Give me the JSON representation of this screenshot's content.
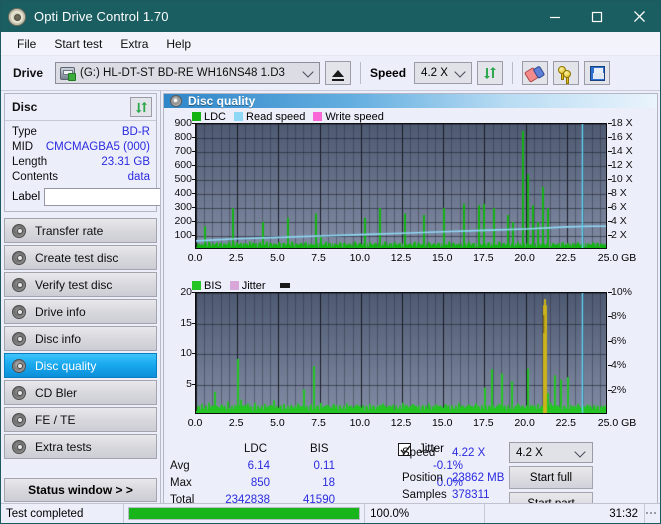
{
  "window": {
    "title": "Opti Drive Control 1.70",
    "icon": "disc-icon",
    "minimize": "minimize-icon",
    "maximize": "maximize-icon",
    "close": "close-icon"
  },
  "menu": {
    "items": [
      "File",
      "Start test",
      "Extra",
      "Help"
    ]
  },
  "toolbar": {
    "drive_label": "Drive",
    "drive_value": "(G:)   HL-DT-ST BD-RE  WH16NS48 1.D3",
    "eject_icon": "eject-icon",
    "speed_label": "Speed",
    "speed_value": "4.2 X",
    "refresh_icon": "refresh-icon",
    "erase_icon": "eraser-icon",
    "keys_icon": "keys-icon",
    "save_icon": "floppy-disk-icon"
  },
  "sidebar": {
    "disc_panel": {
      "title": "Disc",
      "refresh_icon": "refresh-icon",
      "rows": [
        {
          "key": "Type",
          "value": "BD-R"
        },
        {
          "key": "MID",
          "value": "CMCMAGBA5 (000)"
        },
        {
          "key": "Length",
          "value": "23.31 GB"
        },
        {
          "key": "Contents",
          "value": "data"
        }
      ],
      "label_key": "Label",
      "label_value": "",
      "label_placeholder": "",
      "label_button_icon": "disc-icon"
    },
    "nav": [
      {
        "label": "Transfer rate",
        "active": false
      },
      {
        "label": "Create test disc",
        "active": false
      },
      {
        "label": "Verify test disc",
        "active": false
      },
      {
        "label": "Drive info",
        "active": false
      },
      {
        "label": "Disc info",
        "active": false
      },
      {
        "label": "Disc quality",
        "active": true
      },
      {
        "label": "CD Bler",
        "active": false
      },
      {
        "label": "FE / TE",
        "active": false
      },
      {
        "label": "Extra tests",
        "active": false
      }
    ],
    "status_window_button": "Status window > >"
  },
  "main": {
    "panel_title": "Disc quality",
    "panel_icon": "disc-quality-icon"
  },
  "stats": {
    "col_headers": [
      "LDC",
      "BIS"
    ],
    "row_labels": [
      "Avg",
      "Max",
      "Total"
    ],
    "ldc": {
      "avg": "6.14",
      "max": "850",
      "total": "2342838"
    },
    "bis": {
      "avg": "0.11",
      "max": "18",
      "total": "41590"
    },
    "jitter": {
      "label": "Jitter",
      "checked": true,
      "avg": "-0.1%",
      "max": "0.0%"
    },
    "speed_label": "Speed",
    "speed_value": "4.22 X",
    "speed_select": "4.2 X",
    "position_label": "Position",
    "position_value": "23862 MB",
    "samples_label": "Samples",
    "samples_value": "378311",
    "start_full_button": "Start full",
    "start_part_button": "Start part"
  },
  "statusbar": {
    "message": "Test completed",
    "progress_percent": "100.0%",
    "progress_value": 100,
    "elapsed": "31:32"
  },
  "colors": {
    "title_bar": "#1b5e62",
    "accent": "#0b8fd8",
    "ldc_green": "#12b312",
    "read_speed_blue": "#8fd8f5",
    "write_speed_pink": "#f866d8",
    "bis_green": "#23c423",
    "jitter_pink": "#d9a6d9",
    "jitter_trace": "#cbb31a",
    "plot_bg_top": "#4e5a72",
    "plot_bg_bottom": "#7d88a0",
    "value_blue": "#2a2ae0",
    "progress_green": "#17b51a"
  },
  "chart_data": [
    {
      "id": "ldc-chart",
      "type": "bar",
      "title": "",
      "legend": [
        {
          "label": "LDC",
          "color": "#12b312"
        },
        {
          "label": "Read speed",
          "color": "#8fd8f5"
        },
        {
          "label": "Write speed",
          "color": "#f866d8"
        }
      ],
      "legend_position": "top-left",
      "grid": true,
      "xlabel": "GB",
      "xlim": [
        0,
        25
      ],
      "xticks": [
        "0.0",
        "2.5",
        "5.0",
        "7.5",
        "10.0",
        "12.5",
        "15.0",
        "17.5",
        "20.0",
        "22.5",
        "25.0"
      ],
      "xtick_suffix": "GB",
      "ylabel": "",
      "ylim": [
        0,
        900
      ],
      "yticks": [
        100,
        200,
        300,
        400,
        500,
        600,
        700,
        800,
        900
      ],
      "y2label": "",
      "y2lim": [
        0,
        18
      ],
      "y2ticks": [
        "2 X",
        "4 X",
        "6 X",
        "8 X",
        "10 X",
        "12 X",
        "14 X",
        "16 X",
        "18 X"
      ],
      "series": [
        {
          "name": "LDC",
          "color": "#12b312",
          "type": "bar",
          "x": [
            0.15,
            0.3,
            0.5,
            0.7,
            0.95,
            1.2,
            1.45,
            1.7,
            1.95,
            2.2,
            2.45,
            2.7,
            2.85,
            3.0,
            3.2,
            3.4,
            3.6,
            3.8,
            4.0,
            4.25,
            4.5,
            4.75,
            5.0,
            5.25,
            5.5,
            5.75,
            6.0,
            6.3,
            6.6,
            6.9,
            7.2,
            7.5,
            7.8,
            8.1,
            8.4,
            8.7,
            9.0,
            9.3,
            9.6,
            9.9,
            10.2,
            10.5,
            10.8,
            11.1,
            11.4,
            11.7,
            12.0,
            12.3,
            12.6,
            12.9,
            13.2,
            13.5,
            13.8,
            14.1,
            14.4,
            14.7,
            15.0,
            15.3,
            15.6,
            15.9,
            16.2,
            16.5,
            16.8,
            17.1,
            17.4,
            17.7,
            18.0,
            18.3,
            18.6,
            18.9,
            19.2,
            19.5,
            19.8,
            20.1,
            20.4,
            20.7,
            21.0,
            21.3,
            21.6,
            21.9,
            22.2,
            22.5,
            22.8,
            23.1,
            23.4,
            23.7,
            24.0,
            24.3,
            24.6
          ],
          "values": [
            40,
            35,
            170,
            60,
            45,
            55,
            50,
            45,
            60,
            300,
            55,
            50,
            45,
            40,
            60,
            50,
            45,
            55,
            200,
            60,
            50,
            45,
            55,
            50,
            230,
            60,
            45,
            50,
            55,
            45,
            260,
            95,
            60,
            50,
            45,
            55,
            50,
            45,
            60,
            50,
            230,
            55,
            50,
            300,
            60,
            45,
            55,
            50,
            260,
            45,
            60,
            50,
            250,
            55,
            45,
            50,
            300,
            60,
            50,
            45,
            330,
            60,
            50,
            320,
            330,
            55,
            300,
            60,
            50,
            250,
            200,
            60,
            850,
            540,
            320,
            200,
            450,
            300,
            50,
            45,
            55,
            50,
            45,
            55,
            50,
            45,
            55,
            50,
            45
          ]
        },
        {
          "name": "Read speed",
          "color": "#8fd8f5",
          "type": "line",
          "axis": "right",
          "x": [
            0.0,
            2.5,
            5.0,
            7.5,
            10.0,
            12.5,
            15.0,
            17.5,
            20.0,
            22.5,
            24.0,
            25.0
          ],
          "values": [
            1.3,
            1.6,
            1.8,
            2.0,
            2.2,
            2.4,
            2.6,
            2.8,
            3.0,
            3.3,
            3.4,
            3.4
          ]
        },
        {
          "name": "Write speed",
          "color": "#f866d8",
          "type": "line",
          "axis": "right",
          "x": [],
          "values": []
        }
      ],
      "markers": [
        {
          "name": "position-cursor",
          "x": 23.4,
          "color": "#5fd3f5"
        }
      ]
    },
    {
      "id": "bis-chart",
      "type": "bar",
      "title": "",
      "legend": [
        {
          "label": "BIS",
          "color": "#23c423"
        },
        {
          "label": "Jitter",
          "color": "#d9a6d9"
        }
      ],
      "legend_position": "top-left",
      "grid": true,
      "xlabel": "GB",
      "xlim": [
        0,
        25
      ],
      "xticks": [
        "0.0",
        "2.5",
        "5.0",
        "7.5",
        "10.0",
        "12.5",
        "15.0",
        "17.5",
        "20.0",
        "22.5",
        "25.0"
      ],
      "xtick_suffix": "GB",
      "ylim": [
        0,
        20
      ],
      "yticks": [
        5,
        10,
        15,
        20
      ],
      "y2lim": [
        0,
        10
      ],
      "y2ticks": [
        "2%",
        "4%",
        "6%",
        "8%",
        "10%"
      ],
      "series": [
        {
          "name": "BIS",
          "color": "#23c423",
          "type": "bar",
          "x": [
            0.1,
            0.3,
            0.5,
            0.7,
            0.9,
            1.1,
            1.3,
            1.5,
            1.7,
            1.9,
            2.1,
            2.3,
            2.5,
            2.7,
            2.9,
            3.1,
            3.3,
            3.5,
            3.7,
            3.9,
            4.1,
            4.3,
            4.5,
            4.7,
            4.9,
            5.1,
            5.3,
            5.5,
            5.7,
            5.9,
            6.1,
            6.3,
            6.5,
            6.7,
            6.9,
            7.1,
            7.3,
            7.5,
            7.7,
            7.9,
            8.1,
            8.3,
            8.5,
            8.7,
            8.9,
            9.1,
            9.3,
            9.5,
            9.7,
            9.9,
            10.1,
            10.3,
            10.5,
            10.7,
            10.9,
            11.1,
            11.3,
            11.5,
            11.7,
            11.9,
            12.1,
            12.3,
            12.5,
            12.7,
            12.9,
            13.1,
            13.3,
            13.5,
            13.7,
            13.9,
            14.1,
            14.3,
            14.5,
            14.7,
            14.9,
            15.1,
            15.3,
            15.5,
            15.7,
            15.9,
            16.1,
            16.3,
            16.5,
            16.7,
            16.9,
            17.1,
            17.3,
            17.5,
            17.7,
            17.9,
            18.1,
            18.3,
            18.5,
            18.7,
            18.9,
            19.1,
            19.3,
            19.5,
            19.7,
            19.9,
            20.1,
            20.3,
            20.5,
            20.7,
            20.9,
            21.1,
            21.3,
            21.5,
            21.7,
            21.9,
            22.1,
            22.3,
            22.5,
            22.7,
            22.9,
            23.1,
            23.3,
            23.5,
            23.7,
            23.9,
            24.1,
            24.3,
            24.5,
            24.7
          ],
          "values": [
            1.4,
            1.8,
            1.2,
            2.0,
            1.5,
            3.8,
            1.3,
            1.7,
            1.2,
            2.2,
            1.4,
            1.6,
            9.2,
            2.5,
            1.6,
            1.9,
            1.3,
            2.0,
            1.5,
            1.2,
            1.8,
            1.3,
            1.6,
            2.4,
            1.2,
            1.5,
            1.8,
            1.3,
            1.6,
            1.2,
            1.9,
            1.4,
            4.2,
            1.3,
            1.7,
            8.0,
            1.5,
            2.0,
            1.3,
            1.6,
            1.2,
            1.8,
            1.4,
            1.6,
            1.3,
            1.9,
            1.5,
            1.2,
            1.7,
            1.4,
            1.6,
            1.3,
            1.8,
            1.5,
            1.2,
            1.6,
            1.9,
            1.3,
            1.5,
            1.7,
            1.4,
            1.2,
            2.0,
            1.6,
            1.3,
            1.8,
            1.5,
            1.2,
            1.6,
            1.4,
            1.9,
            1.3,
            1.7,
            1.5,
            1.2,
            1.8,
            1.4,
            1.6,
            1.3,
            2.0,
            1.5,
            1.2,
            1.7,
            1.4,
            1.9,
            1.3,
            1.6,
            4.5,
            1.5,
            7.5,
            1.2,
            1.8,
            6.8,
            1.4,
            1.6,
            5.5,
            1.3,
            1.9,
            1.5,
            1.2,
            7.6,
            1.6,
            1.4,
            1.8,
            1.3,
            17.5,
            3.6,
            2.0,
            6.5,
            1.5,
            5.8,
            1.3,
            6.2,
            1.6,
            1.4,
            1.8,
            1.2,
            1.5,
            1.7,
            1.3,
            1.6,
            1.4,
            1.2,
            1.5
          ]
        },
        {
          "name": "Jitter",
          "color": "#cbb31a",
          "type": "line",
          "axis": "right",
          "x": [
            21.05,
            21.1,
            21.15
          ],
          "values": [
            9.0,
            9.5,
            9.0
          ]
        }
      ],
      "markers": [
        {
          "name": "position-cursor",
          "x": 23.4,
          "color": "#5fd3f5"
        }
      ]
    }
  ]
}
